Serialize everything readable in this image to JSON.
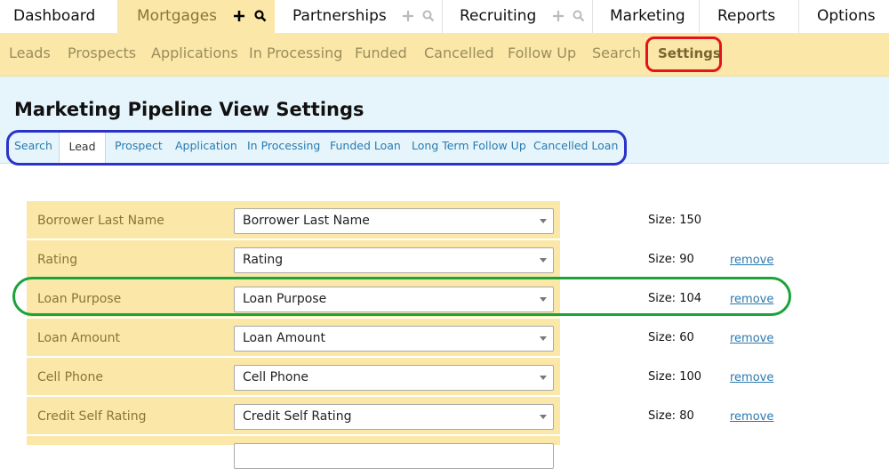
{
  "topnav": {
    "tabs": [
      {
        "label": "Dashboard",
        "active": false
      },
      {
        "label": "Mortgages",
        "active": true
      },
      {
        "label": "Partnerships",
        "active": false
      },
      {
        "label": "Recruiting",
        "active": false
      },
      {
        "label": "Marketing",
        "active": false
      },
      {
        "label": "Reports",
        "active": false
      },
      {
        "label": "Options",
        "active": false
      }
    ]
  },
  "subnav": {
    "items": [
      {
        "label": "Leads"
      },
      {
        "label": "Prospects"
      },
      {
        "label": "Applications"
      },
      {
        "label": "In Processing"
      },
      {
        "label": "Funded"
      },
      {
        "label": "Cancelled"
      },
      {
        "label": "Follow Up"
      },
      {
        "label": "Search"
      },
      {
        "label": "Settings",
        "active": true
      }
    ]
  },
  "page": {
    "title": "Marketing Pipeline View Settings"
  },
  "view_tabs": [
    {
      "label": "Search"
    },
    {
      "label": "Lead",
      "active": true
    },
    {
      "label": "Prospect"
    },
    {
      "label": "Application"
    },
    {
      "label": "In Processing"
    },
    {
      "label": "Funded Loan"
    },
    {
      "label": "Long Term Follow Up"
    },
    {
      "label": "Cancelled Loan"
    }
  ],
  "columns": [
    {
      "label": "Borrower Last Name",
      "selected": "Borrower Last Name",
      "size": "Size: 150",
      "remove": ""
    },
    {
      "label": "Rating",
      "selected": "Rating",
      "size": "Size: 90",
      "remove": "remove"
    },
    {
      "label": "Loan Purpose",
      "selected": "Loan Purpose",
      "size": "Size: 104",
      "remove": "remove"
    },
    {
      "label": "Loan Amount",
      "selected": "Loan Amount",
      "size": "Size: 60",
      "remove": "remove"
    },
    {
      "label": "Cell Phone",
      "selected": "Cell Phone",
      "size": "Size: 100",
      "remove": "remove"
    },
    {
      "label": "Credit Self Rating",
      "selected": "Credit Self Rating",
      "size": "Size: 80",
      "remove": "remove"
    }
  ],
  "colors": {
    "accent_yellow": "#fbe8a8",
    "header_band": "#e6f5fc",
    "link_blue": "#2a7ab0",
    "annotation_red": "#e3141b",
    "annotation_blue": "#2a33c8",
    "annotation_green": "#1aa33a"
  },
  "icons": {
    "add": "plus-icon",
    "search": "search-icon",
    "dropdown": "chevron-down-icon"
  }
}
